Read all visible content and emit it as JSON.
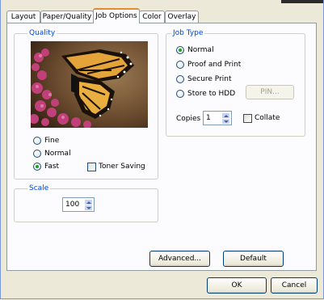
{
  "tabs": [
    {
      "label": "Layout"
    },
    {
      "label": "Paper/Quality"
    },
    {
      "label": "Job Options"
    },
    {
      "label": "Color"
    },
    {
      "label": "Overlay"
    }
  ],
  "active_tab": "Job Options",
  "quality": {
    "legend": "Quality",
    "options": [
      {
        "label": "Fine",
        "selected": false
      },
      {
        "label": "Normal",
        "selected": false
      },
      {
        "label": "Fast",
        "selected": true
      }
    ],
    "toner_saving": {
      "label": "Toner Saving",
      "checked": false
    }
  },
  "scale": {
    "legend": "Scale",
    "value": "100"
  },
  "job_type": {
    "legend": "Job Type",
    "options": [
      {
        "label": "Normal",
        "selected": true
      },
      {
        "label": "Proof and Print",
        "selected": false
      },
      {
        "label": "Secure Print",
        "selected": false
      },
      {
        "label": "Store to HDD",
        "selected": false
      }
    ],
    "pin_button": "PIN...",
    "copies_label": "Copies",
    "copies_value": "1",
    "collate": {
      "label": "Collate",
      "checked": false
    }
  },
  "buttons": {
    "advanced": "Advanced...",
    "default": "Default",
    "ok": "OK",
    "cancel": "Cancel"
  },
  "colors": {
    "accent_tab": "#e68b2c",
    "group_label": "#0046d5",
    "radio_dot": "#21a121"
  }
}
